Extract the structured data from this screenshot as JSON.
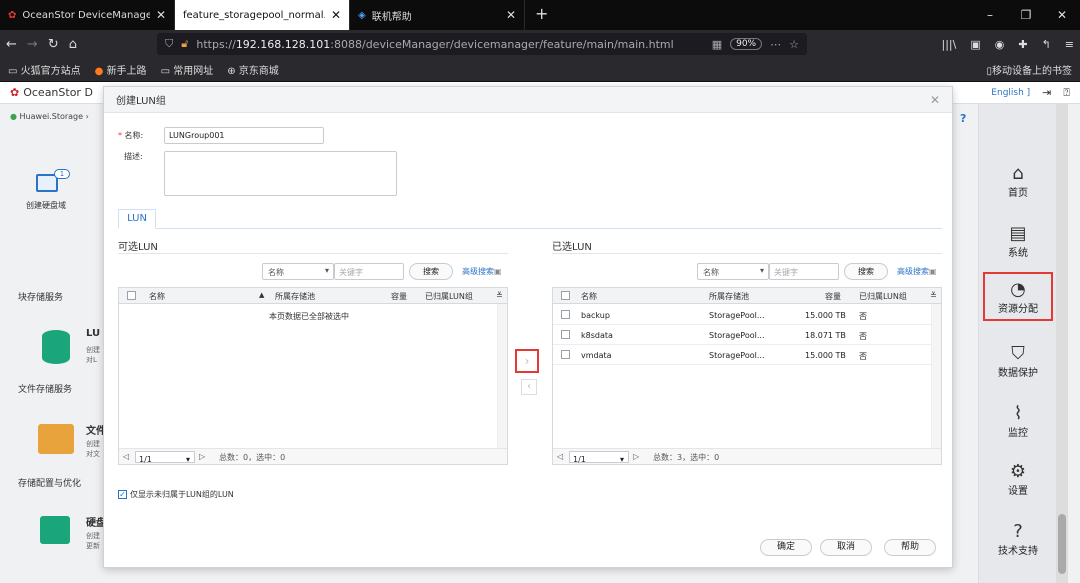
{
  "browser": {
    "tabs": [
      {
        "title": "OceanStor DeviceManager",
        "active": false
      },
      {
        "title": "feature_storagepool_normal.png",
        "active": true
      },
      {
        "title": "联机帮助",
        "active": false
      }
    ],
    "new_tab": "+",
    "url_prefix": "https://",
    "url_host": "192.168.128.101",
    "url_rest": ":8088/deviceManager/devicemanager/feature/main/main.html",
    "zoom": "90%",
    "bookmarks": [
      "火狐官方站点",
      "新手上路",
      "常用网址",
      "京东商城"
    ],
    "mobile_bookmarks": "移动设备上的书签"
  },
  "app": {
    "title": "OceanStor D",
    "english": "English",
    "breadcrumb": "Huawei.Storage",
    "create_disk_domain": "创建硬盘域",
    "sections": {
      "block": "块存储服务",
      "file": "文件存储服务",
      "config": "存储配置与优化"
    },
    "lun_title": "LU",
    "lun_desc1": "创建",
    "lun_desc2": "对L",
    "file_title": "文件",
    "file_desc1": "创建",
    "file_desc2": "对文",
    "disk_title": "硬盘",
    "disk_desc1": "创建",
    "disk_desc2": "更新",
    "right_nav": [
      {
        "label": "首页",
        "icon": "home-icon"
      },
      {
        "label": "系统",
        "icon": "system-icon"
      },
      {
        "label": "资源分配",
        "icon": "resource-icon"
      },
      {
        "label": "数据保护",
        "icon": "shield-icon"
      },
      {
        "label": "监控",
        "icon": "monitor-icon"
      },
      {
        "label": "设置",
        "icon": "gear-icon"
      },
      {
        "label": "技术支持",
        "icon": "help-icon"
      }
    ]
  },
  "modal": {
    "title": "创建LUN组",
    "name_label": "名称:",
    "name_value": "LUNGroup001",
    "desc_label": "描述:",
    "tab": "LUN",
    "available": {
      "title": "可选LUN",
      "filter_field": "名称",
      "keyword_placeholder": "关键字",
      "search": "搜索",
      "advanced": "高级搜索",
      "columns": [
        "名称",
        "所属存储池",
        "容量",
        "已归属LUN组"
      ],
      "empty_text": "本页数据已全部被选中",
      "page": "1/1",
      "summary": "总数：0，选中：0"
    },
    "selected": {
      "title": "已选LUN",
      "filter_field": "名称",
      "keyword_placeholder": "关键字",
      "search": "搜索",
      "advanced": "高级搜索",
      "columns": [
        "名称",
        "所属存储池",
        "容量",
        "已归属LUN组"
      ],
      "rows": [
        {
          "name": "backup",
          "pool": "StoragePool...",
          "capacity": "15.000 TB",
          "grouped": "否"
        },
        {
          "name": "k8sdata",
          "pool": "StoragePool...",
          "capacity": "18.071 TB",
          "grouped": "否"
        },
        {
          "name": "vmdata",
          "pool": "StoragePool...",
          "capacity": "15.000 TB",
          "grouped": "否"
        }
      ],
      "page": "1/1",
      "summary": "总数：3，选中：0"
    },
    "only_ungrouped": "仅显示未归属于LUN组的LUN",
    "ok": "确定",
    "cancel": "取消",
    "help": "帮助"
  }
}
